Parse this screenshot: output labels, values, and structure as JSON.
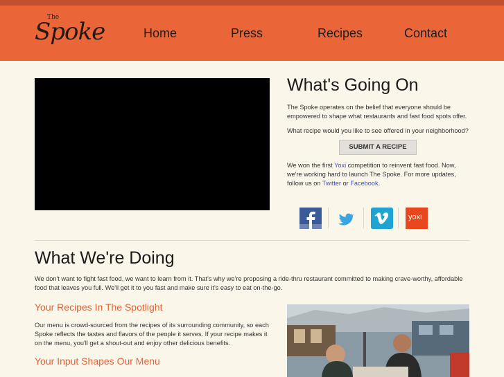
{
  "brand": {
    "small": "The",
    "name": "Spoke"
  },
  "nav": {
    "home": "Home",
    "press": "Press",
    "recipes": "Recipes",
    "contact": "Contact"
  },
  "going": {
    "title": "What's Going On",
    "p1": "The Spoke operates on the belief that everyone should be empowered to shape what restaurants and fast food spots offer.",
    "p2": "What recipe would you like to see offered in your neighborhood?",
    "submit_label": "SUBMIT A RECIPE",
    "p3_a": "We won the first ",
    "p3_yoxi": "Yoxi",
    "p3_b": " competition to reinvent fast food. Now, we're working hard to launch The Spoke. For more updates, follow us on ",
    "p3_twitter": "Twitter",
    "p3_c": " or ",
    "p3_facebook": "Facebook",
    "p3_d": "."
  },
  "social": {
    "yoxi_text": "yoxi"
  },
  "doing": {
    "title": "What We're Doing",
    "p": "We don't want to fight fast food, we want to learn from it. That's why we're proposing a ride-thru restaurant committed to making crave-worthy, affordable food that leaves you full. We'll get it to you fast and make sure it's easy to eat on-the-go.",
    "h_spotlight": "Your Recipes In The Spotlight",
    "p_spotlight": "Our menu is crowd-sourced from the recipes of its surrounding community, so each Spoke reflects the tastes and flavors of the people it serves. If your recipe makes it on the menu, you'll get a shout-out and enjoy other delicious benefits.",
    "h_input": "Your Input Shapes Our Menu"
  },
  "colors": {
    "header": "#ea6537",
    "topbar": "#c0502e",
    "accent": "#e0633a",
    "link": "#3b4fc4",
    "background": "#fbf6ea"
  }
}
